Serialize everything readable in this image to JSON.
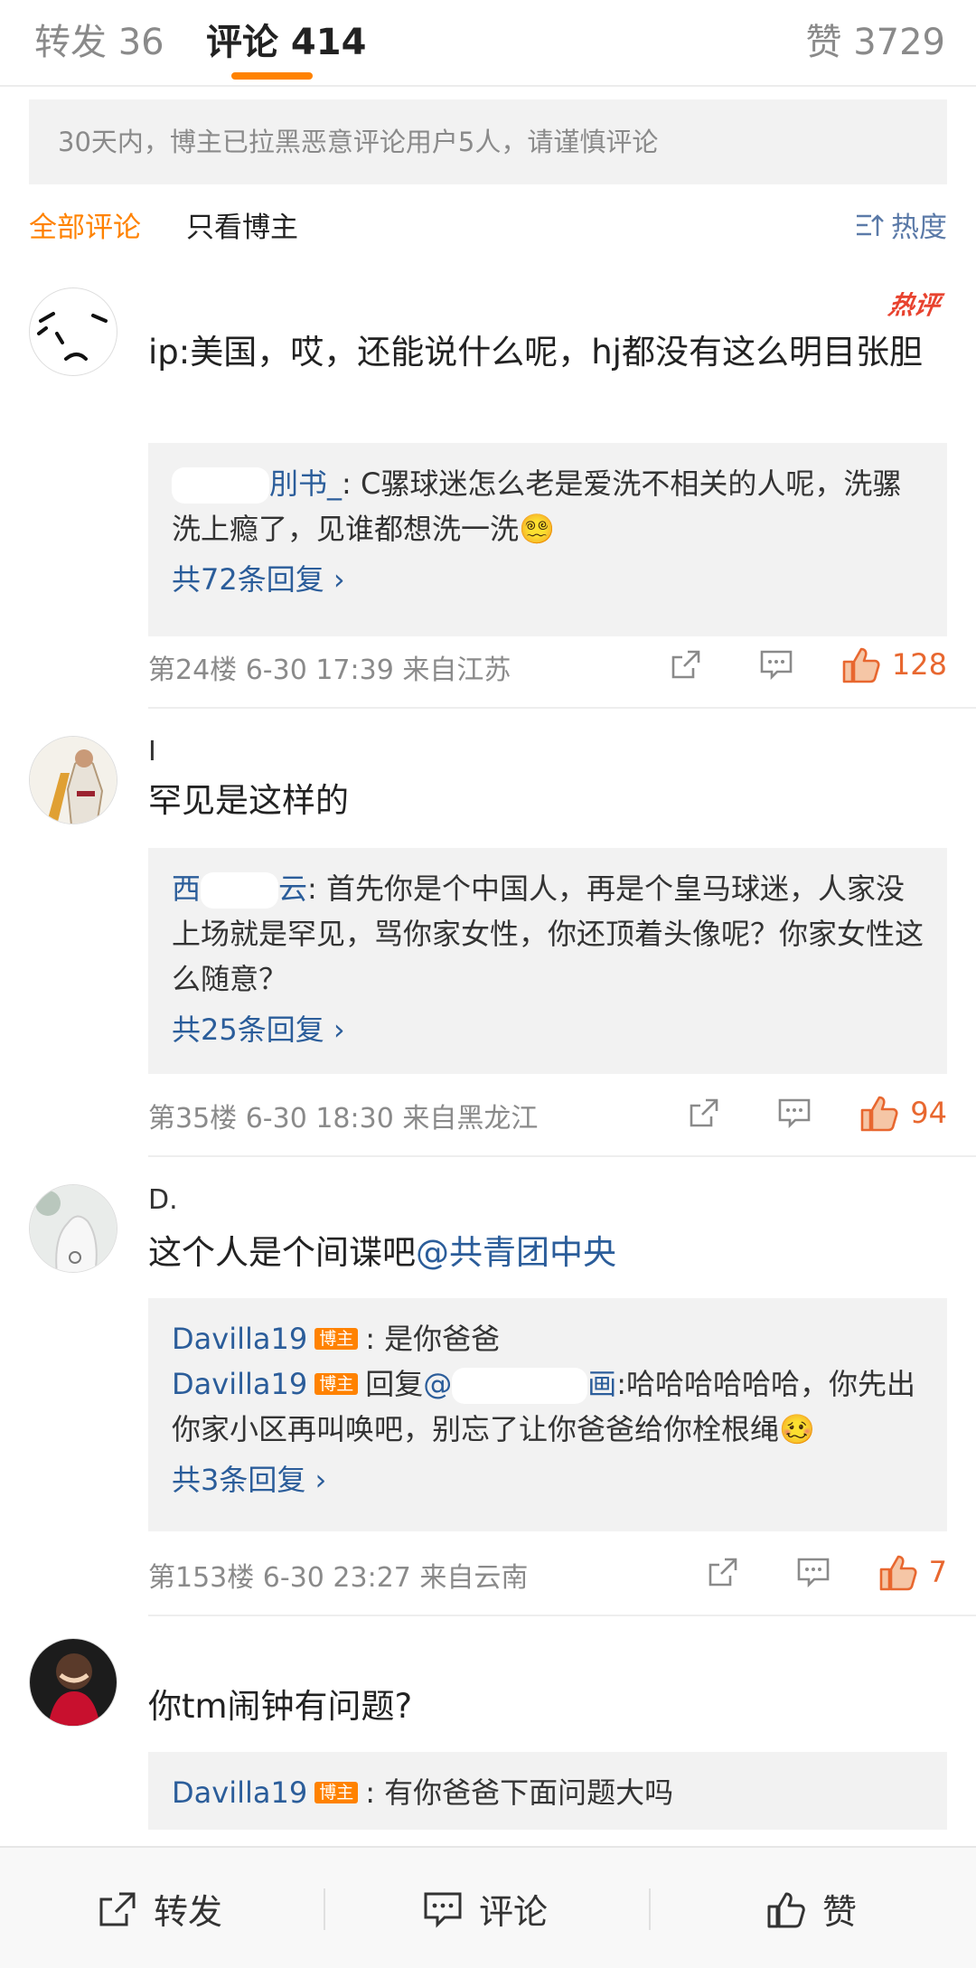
{
  "tabs": {
    "repost": "转发 36",
    "comment": "评论 414",
    "like": "赞 3729"
  },
  "notice": "30天内，博主已拉黑恶意评论用户5人，请谨慎评论",
  "filter": {
    "all": "全部评论",
    "owner_only": "只看博主",
    "sort": "热度"
  },
  "owner_tag": "博主",
  "comments": [
    {
      "username": "",
      "hot_badge": "热评",
      "text": "ip:美国，哎，还能说什么呢，hj都没有这么明目张胆",
      "reply": {
        "name": "刖书_",
        "text": ": C骡球迷怎么老是爱洗不相关的人呢，洗骡洗上瘾了，见谁都想洗一洗😵‍💫",
        "more": "共72条回复 ›"
      },
      "meta": "第24楼  6-30 17:39  来自江苏",
      "likes": "128"
    },
    {
      "username": "I",
      "text": "罕见是这样的",
      "reply": {
        "name_start": "西",
        "name_end": "云",
        "text": ": 首先你是个中国人，再是个皇马球迷，人家没上场就是罕见，骂你家女性，你还顶着头像呢？你家女性这么随意？",
        "more": "共25条回复 ›"
      },
      "meta": "第35楼  6-30 18:30  来自黑龙江",
      "likes": "94"
    },
    {
      "username": "D.",
      "text_plain": "这个人是个间谍吧",
      "text_mention": "@共青团中央",
      "replies": [
        {
          "name": "Davilla19",
          "text": ": 是你爸爸"
        },
        {
          "name": "Davilla19",
          "reply_prefix": "回复",
          "mention_start": "@",
          "mention_end": "画",
          "text": ":哈哈哈哈哈哈，你先出你家小区再叫唤吧，别忘了让你爸爸给你栓根绳🥴"
        }
      ],
      "more": "共3条回复 ›",
      "meta": "第153楼  6-30 23:27  来自云南",
      "likes": "7"
    },
    {
      "username": "",
      "text": "你tm闹钟有问题?",
      "reply": {
        "name": "Davilla19",
        "text": ": 有你爸爸下面问题大吗"
      }
    }
  ],
  "bottom_bar": {
    "repost": "转发",
    "comment": "评论",
    "like": "赞"
  },
  "colors": {
    "accent": "#ff8200",
    "link": "#2b5d9a",
    "hot": "#e8432f",
    "like": "#e8672f"
  }
}
